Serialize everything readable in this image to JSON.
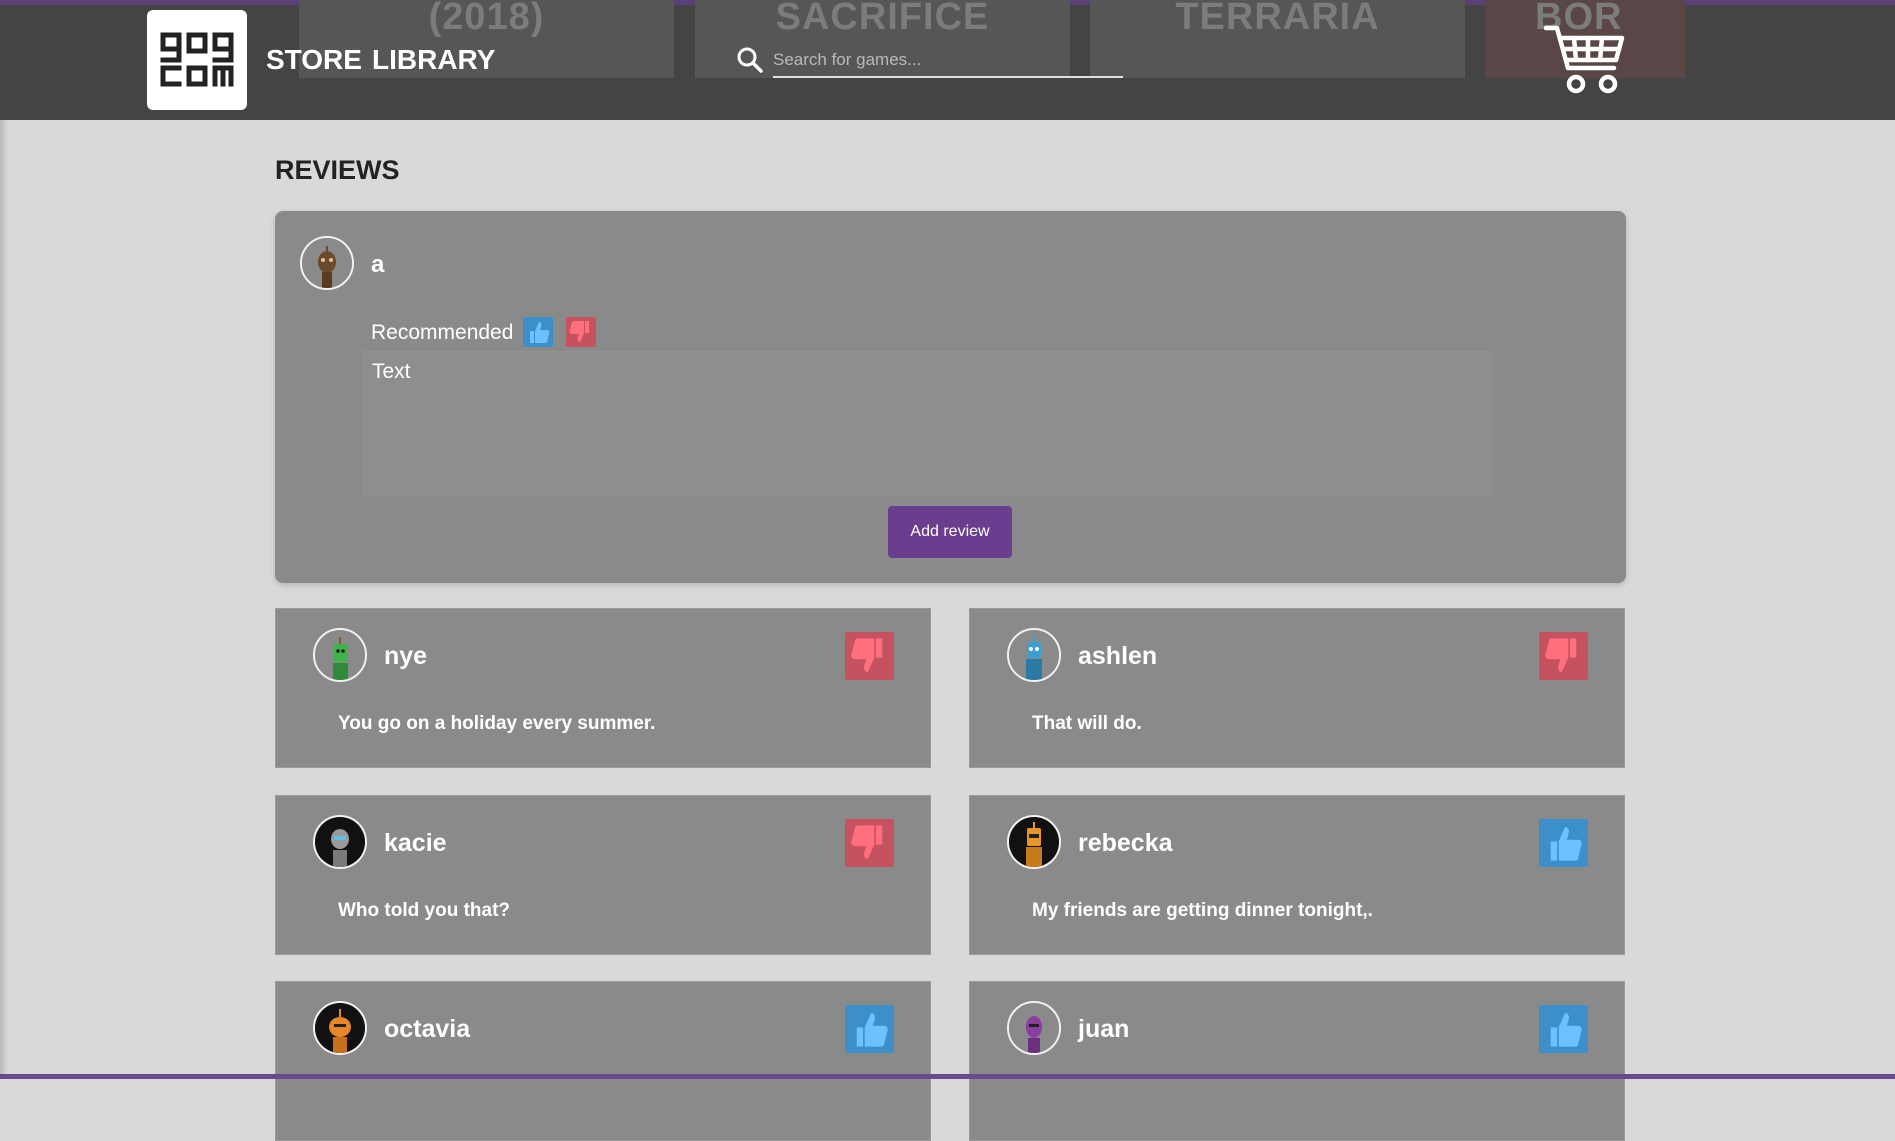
{
  "header": {
    "logo_text_line1": "gog",
    "logo_text_line2": "com",
    "nav": {
      "store": "STORE",
      "library": "LIBRARY"
    },
    "search": {
      "placeholder": "Search for games...",
      "icon": "search-icon"
    },
    "cart_icon": "cart-icon",
    "banners": [
      "(2018)",
      "SACRIFICE",
      "TERRARIA",
      "BOR"
    ]
  },
  "reviews": {
    "title": "REVIEWS",
    "compose": {
      "username": "a",
      "recommended_label": "Recommended",
      "textarea_value": "Text",
      "submit_label": "Add review"
    },
    "items": [
      {
        "user": "nye",
        "text": "You go on a holiday every summer.",
        "recommended": false
      },
      {
        "user": "ashlen",
        "text": "That will do.",
        "recommended": false
      },
      {
        "user": "kacie",
        "text": "Who told you that?",
        "recommended": false
      },
      {
        "user": "rebecka",
        "text": "My friends are getting dinner tonight,.",
        "recommended": true
      },
      {
        "user": "octavia",
        "text": "",
        "recommended": true
      },
      {
        "user": "juan",
        "text": "",
        "recommended": true
      }
    ]
  },
  "colors": {
    "header_bg": "#444444",
    "page_bg": "#d9d9d9",
    "card_bg": "#8a8a8a",
    "thumb_up": "#3c8fc8",
    "thumb_down": "#c4525f",
    "accent_purple": "#6a3d8f"
  }
}
